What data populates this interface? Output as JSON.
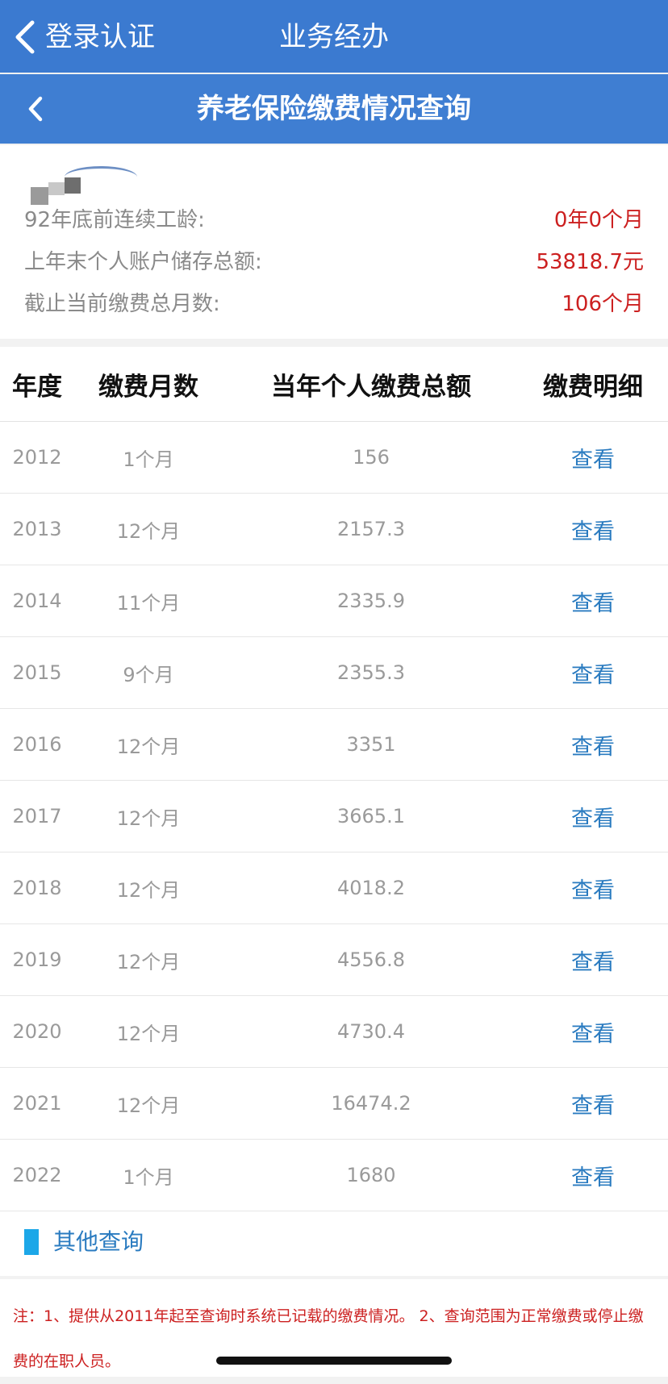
{
  "nav": {
    "back_label": "登录认证",
    "title": "业务经办"
  },
  "subnav": {
    "title": "养老保险缴费情况查询"
  },
  "summary": {
    "rows": [
      {
        "label": "92年底前连续工龄:",
        "value": "0年0个月"
      },
      {
        "label": "上年末个人账户储存总额:",
        "value": "53818.7元"
      },
      {
        "label": "截止当前缴费总月数:",
        "value": "106个月"
      }
    ]
  },
  "table": {
    "headers": [
      "年度",
      "缴费月数",
      "当年个人缴费总额",
      "缴费明细"
    ],
    "rows": [
      {
        "year": "2012",
        "months": "1个月",
        "amount": "156",
        "action": "查看"
      },
      {
        "year": "2013",
        "months": "12个月",
        "amount": "2157.3",
        "action": "查看"
      },
      {
        "year": "2014",
        "months": "11个月",
        "amount": "2335.9",
        "action": "查看"
      },
      {
        "year": "2015",
        "months": "9个月",
        "amount": "2355.3",
        "action": "查看"
      },
      {
        "year": "2016",
        "months": "12个月",
        "amount": "3351",
        "action": "查看"
      },
      {
        "year": "2017",
        "months": "12个月",
        "amount": "3665.1",
        "action": "查看"
      },
      {
        "year": "2018",
        "months": "12个月",
        "amount": "4018.2",
        "action": "查看"
      },
      {
        "year": "2019",
        "months": "12个月",
        "amount": "4556.8",
        "action": "查看"
      },
      {
        "year": "2020",
        "months": "12个月",
        "amount": "4730.4",
        "action": "查看"
      },
      {
        "year": "2021",
        "months": "12个月",
        "amount": "16474.2",
        "action": "查看"
      },
      {
        "year": "2022",
        "months": "1个月",
        "amount": "1680",
        "action": "查看"
      }
    ]
  },
  "other_query": {
    "label": "其他查询"
  },
  "note": {
    "text": "注：1、提供从2011年起至查询时系统已记载的缴费情况。 2、查询范围为正常缴费或停止缴费的在职人员。"
  },
  "colors": {
    "nav_blue": "#3b7ad0",
    "value_red": "#cc2020",
    "link_blue": "#2a7bc0"
  }
}
